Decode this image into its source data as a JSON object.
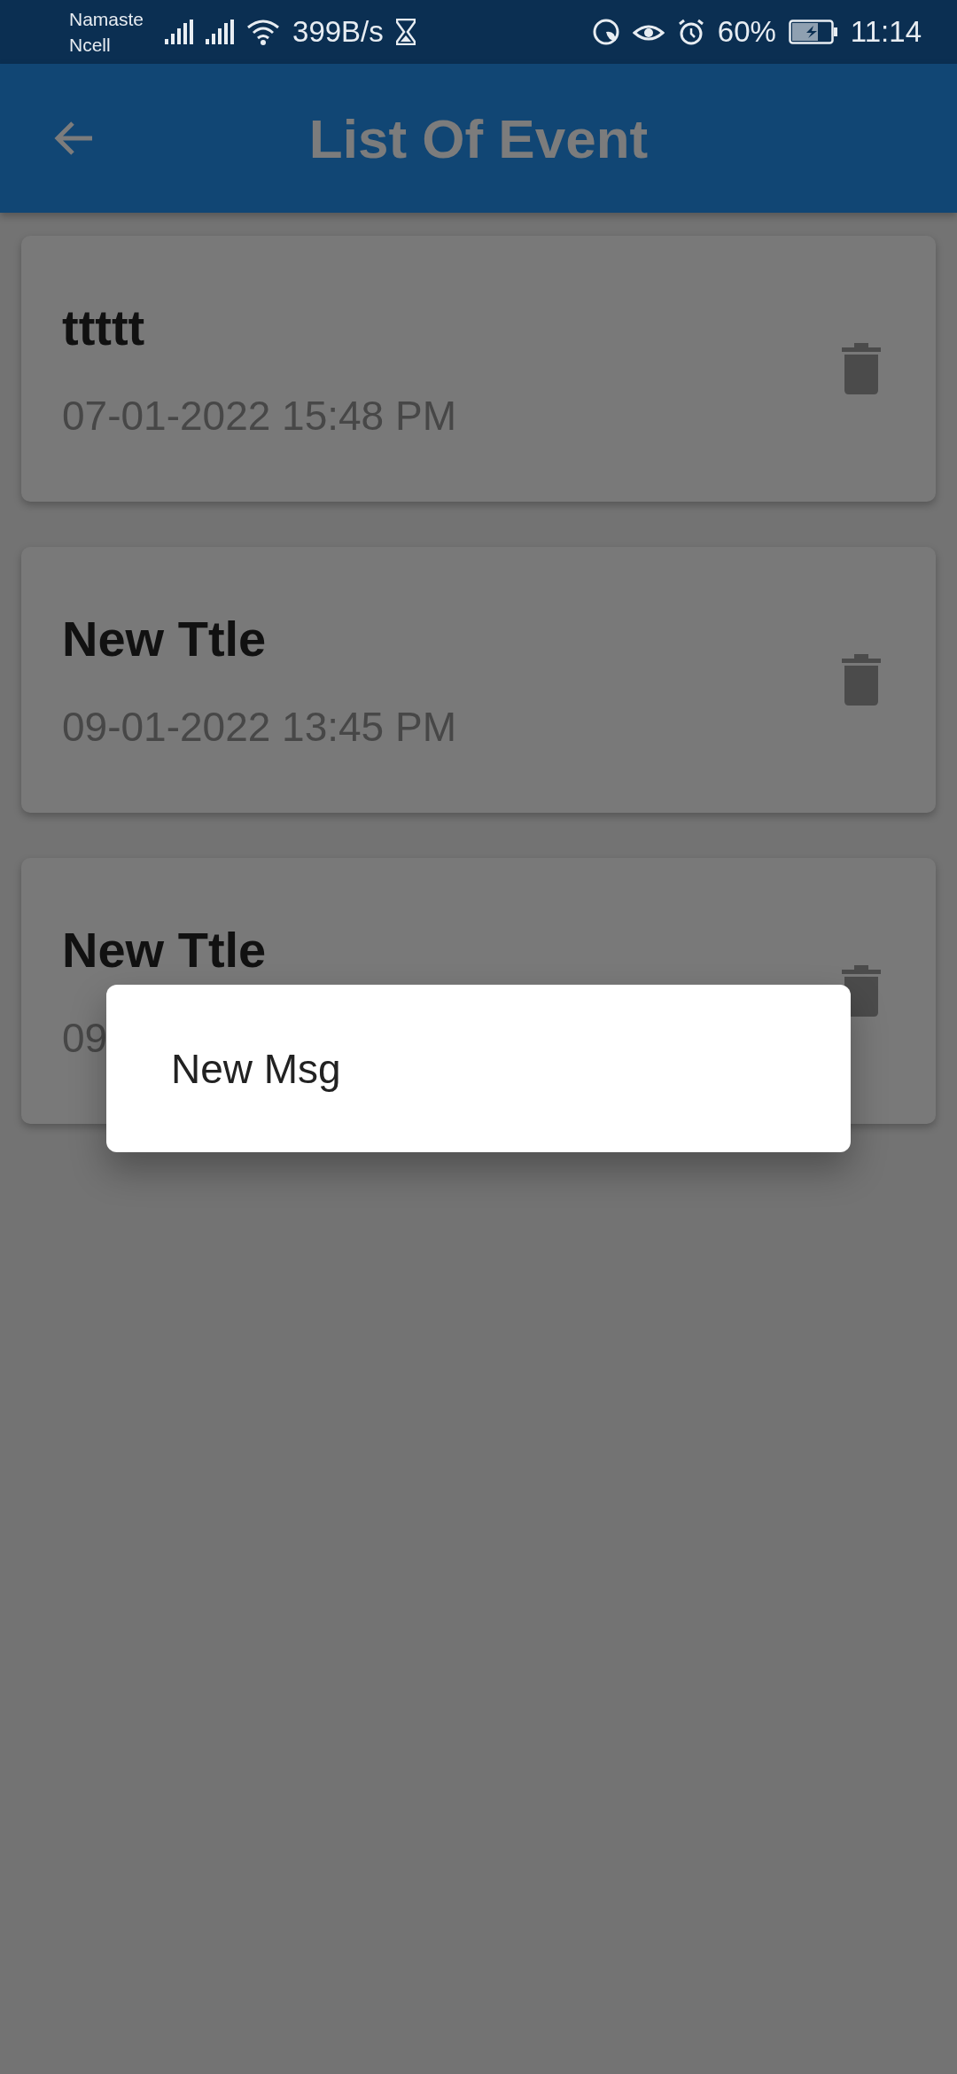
{
  "status_bar": {
    "carrier": [
      "Namaste",
      "Ncell"
    ],
    "speed": "399B/s",
    "battery": "60%",
    "time": "11:14"
  },
  "app_bar": {
    "title": "List Of Event"
  },
  "events": [
    {
      "title": "ttttt",
      "date": "07-01-2022 15:48 PM"
    },
    {
      "title": "New Ttle",
      "date": "09-01-2022 13:45 PM"
    },
    {
      "title": "New Ttle",
      "date": "09"
    }
  ],
  "dialog": {
    "message": "New Msg"
  }
}
